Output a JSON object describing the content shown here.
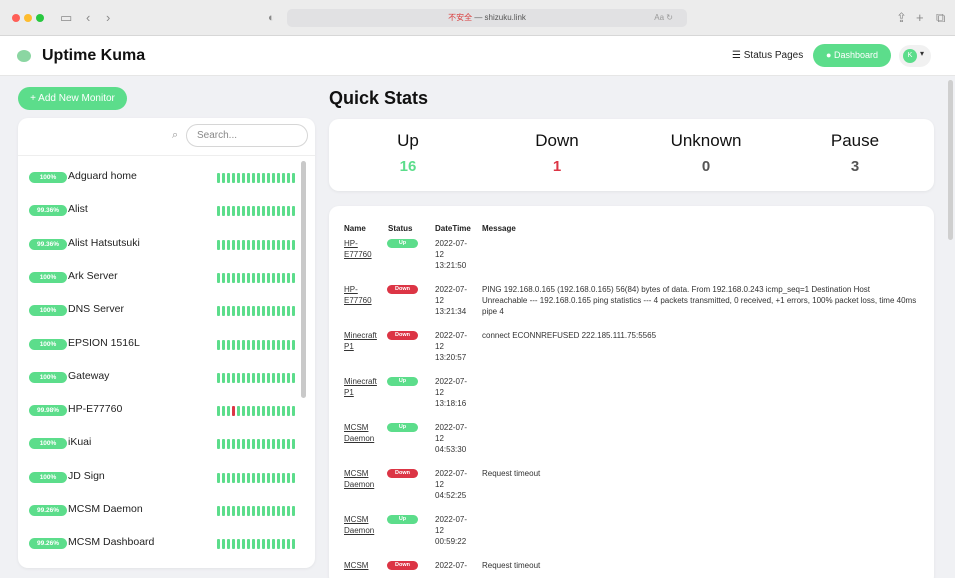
{
  "browser": {
    "url_insecure": "不安全",
    "url_host": "shizuku.link",
    "reader_label": "Aa ↻"
  },
  "header": {
    "brand": "Uptime Kuma",
    "status_pages": "Status Pages",
    "dashboard": "Dashboard",
    "avatar": "K"
  },
  "sidebar": {
    "add_label": "+ Add New Monitor",
    "search_placeholder": "Search...",
    "monitors": [
      {
        "pct": "100%",
        "name": "Adguard home",
        "down_index": -1
      },
      {
        "pct": "99.36%",
        "name": "Alist",
        "down_index": -1
      },
      {
        "pct": "99.36%",
        "name": "Alist Hatsutsuki",
        "down_index": -1
      },
      {
        "pct": "100%",
        "name": "Ark Server",
        "down_index": -1
      },
      {
        "pct": "100%",
        "name": "DNS Server",
        "down_index": -1
      },
      {
        "pct": "100%",
        "name": "EPSION 1516L",
        "down_index": -1
      },
      {
        "pct": "100%",
        "name": "Gateway",
        "down_index": -1
      },
      {
        "pct": "99.98%",
        "name": "HP-E77760",
        "down_index": 3
      },
      {
        "pct": "100%",
        "name": "iKuai",
        "down_index": -1
      },
      {
        "pct": "100%",
        "name": "JD Sign",
        "down_index": -1
      },
      {
        "pct": "99.26%",
        "name": "MCSM Daemon",
        "down_index": -1
      },
      {
        "pct": "99.26%",
        "name": "MCSM Dashboard",
        "down_index": -1
      }
    ]
  },
  "quick_stats": {
    "title": "Quick Stats",
    "items": [
      {
        "label": "Up",
        "value": "16",
        "color": "#5cdd8b"
      },
      {
        "label": "Down",
        "value": "1",
        "color": "#dc3545"
      },
      {
        "label": "Unknown",
        "value": "0",
        "color": "#555555"
      },
      {
        "label": "Pause",
        "value": "3",
        "color": "#555555"
      }
    ]
  },
  "events": {
    "headers": [
      "Name",
      "Status",
      "DateTime",
      "Message"
    ],
    "rows": [
      {
        "name": [
          "HP-",
          "E77760"
        ],
        "status": "Up",
        "kind": "up",
        "time": [
          "2022-07-",
          "12",
          "13:21:50"
        ],
        "message": ""
      },
      {
        "name": [
          "HP-",
          "E77760"
        ],
        "status": "Down",
        "kind": "down",
        "time": [
          "2022-07-",
          "12",
          "13:21:34"
        ],
        "message": "PING 192.168.0.165 (192.168.0.165) 56(84) bytes of data. From 192.168.0.243 icmp_seq=1 Destination Host Unreachable --- 192.168.0.165 ping statistics --- 4 packets transmitted, 0 received, +1 errors, 100% packet loss, time 40ms pipe 4"
      },
      {
        "name": [
          "Minecraft",
          "P1"
        ],
        "status": "Down",
        "kind": "down",
        "time": [
          "2022-07-",
          "12",
          "13:20:57"
        ],
        "message": "connect ECONNREFUSED 222.185.111.75:5565"
      },
      {
        "name": [
          "Minecraft",
          "P1"
        ],
        "status": "Up",
        "kind": "up",
        "time": [
          "2022-07-",
          "12",
          "13:18:16"
        ],
        "message": ""
      },
      {
        "name": [
          "MCSM",
          "Daemon"
        ],
        "status": "Up",
        "kind": "up",
        "time": [
          "2022-07-",
          "12",
          "04:53:30"
        ],
        "message": ""
      },
      {
        "name": [
          "MCSM",
          "Daemon"
        ],
        "status": "Down",
        "kind": "down",
        "time": [
          "2022-07-",
          "12",
          "04:52:25"
        ],
        "message": "Request timeout"
      },
      {
        "name": [
          "MCSM",
          "Daemon"
        ],
        "status": "Up",
        "kind": "up",
        "time": [
          "2022-07-",
          "12",
          "00:59:22"
        ],
        "message": ""
      },
      {
        "name": [
          "MCSM",
          ""
        ],
        "status": "Down",
        "kind": "down",
        "time": [
          "2022-07-",
          "",
          ""
        ],
        "message": "Request timeout"
      }
    ]
  }
}
